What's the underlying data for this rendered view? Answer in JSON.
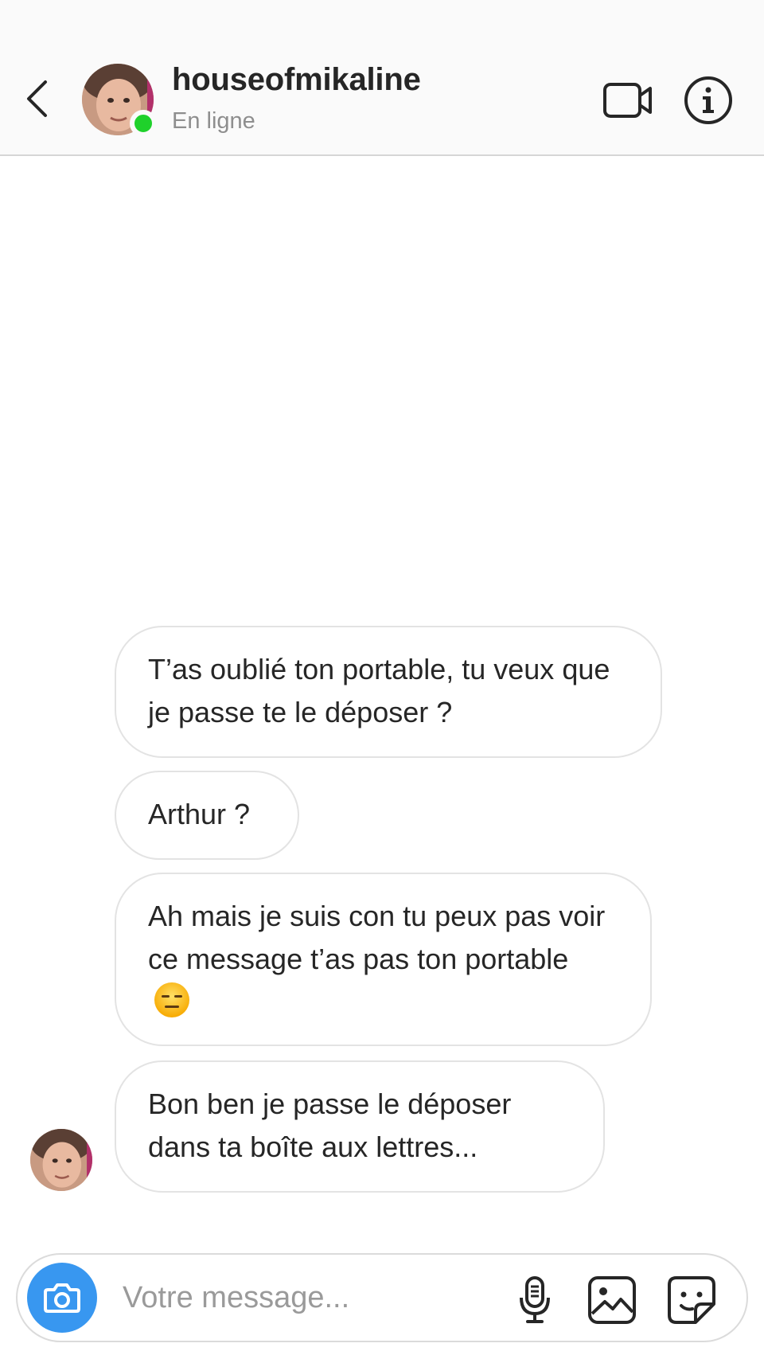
{
  "header": {
    "username": "houseofmikaline",
    "status": "En ligne"
  },
  "messages": [
    {
      "text": "T’as oublié ton portable, tu veux que je passe te le déposer ?"
    },
    {
      "text": "Arthur ?"
    },
    {
      "text": "Ah mais je suis con tu peux pas voir ce message t’as pas ton portable"
    },
    {
      "text": "Bon ben je passe le déposer dans ta boîte aux lettres..."
    }
  ],
  "composer": {
    "placeholder": "Votre message..."
  },
  "icons": {
    "back": "chevron-left-icon",
    "video": "video-camera-icon",
    "info": "info-icon",
    "camera": "camera-icon",
    "mic": "microphone-icon",
    "gallery": "image-icon",
    "sticker": "sticker-icon",
    "emoji": "expressionless-face-emoji"
  },
  "colors": {
    "online": "#1fd12b",
    "camera_button": "#3897f0",
    "bubble_border": "#e3e3e3",
    "secondary_text": "#8e8e8e"
  }
}
